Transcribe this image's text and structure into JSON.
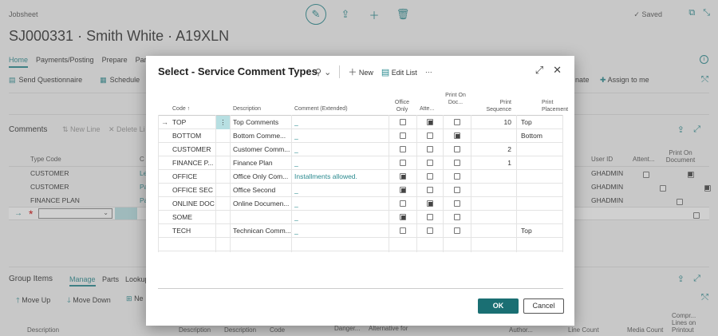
{
  "background": {
    "breadcrumb": "Jobsheet",
    "title": "SJ000331 · Smith White · A19XLN",
    "saved": "Saved",
    "nav": [
      "Home",
      "Payments/Posting",
      "Prepare",
      "Part"
    ],
    "actions": [
      "Send Questionnaire",
      "Schedule"
    ],
    "right_actions": [
      "nate",
      "Assign to me"
    ],
    "comments": {
      "title": "Comments",
      "new_line": "New Line",
      "delete_line": "Delete Li",
      "col_type_code": "Type Code",
      "col_c": "C",
      "col_user_id": "User ID",
      "col_atten": "Attent...",
      "col_print_on_doc": "Print On Document",
      "rows": [
        {
          "type": "CUSTOMER",
          "c": "Le",
          "user": "GHADMIN",
          "att": false,
          "print": true
        },
        {
          "type": "CUSTOMER",
          "c": "Pa",
          "user": "GHADMIN",
          "att": false,
          "print": true
        },
        {
          "type": "FINANCE PLAN",
          "c": "Pa",
          "user": "GHADMIN",
          "att": false,
          "print": false
        }
      ]
    },
    "group_items": {
      "title": "Group Items",
      "tabs": [
        "Manage",
        "Parts",
        "Lookup"
      ],
      "actions": [
        "Move Up",
        "Move Down",
        "Ne"
      ],
      "cols": [
        "Description",
        "Description",
        "Description",
        "Code",
        "Danger...",
        "Alternative for",
        "Author...",
        "Line Count",
        "Media Count",
        "Compr... Lines on Printout"
      ]
    }
  },
  "dialog": {
    "title": "Select - Service Comment Types",
    "new_label": "New",
    "edit_list_label": "Edit List",
    "more": "···",
    "headers": {
      "code": "Code ↑",
      "description": "Description",
      "comment": "Comment (Extended)",
      "office_only": "Office Only",
      "atten": "Atte...",
      "print_on_doc": "Print On Doc...",
      "print_sequence": "Print Sequence",
      "print_placement": "Print Placement"
    },
    "rows": [
      {
        "code": "TOP",
        "description": "Top Comments",
        "comment": "_",
        "office": false,
        "atten": true,
        "print": false,
        "seq": "10",
        "placement": "Top"
      },
      {
        "code": "BOTTOM",
        "description": "Bottom Comme...",
        "comment": "_",
        "office": false,
        "atten": false,
        "print": true,
        "seq": "",
        "placement": "Bottom"
      },
      {
        "code": "CUSTOMER",
        "description": "Customer Comm...",
        "comment": "_",
        "office": false,
        "atten": false,
        "print": false,
        "seq": "2",
        "placement": ""
      },
      {
        "code": "FINANCE P...",
        "description": "Finance Plan",
        "comment": "_",
        "office": false,
        "atten": false,
        "print": false,
        "seq": "1",
        "placement": ""
      },
      {
        "code": "OFFICE",
        "description": "Office Only Com...",
        "comment": "Installments allowed.",
        "office": true,
        "atten": false,
        "print": false,
        "seq": "",
        "placement": ""
      },
      {
        "code": "OFFICE SEC",
        "description": "Office Second",
        "comment": "_",
        "office": true,
        "atten": false,
        "print": false,
        "seq": "",
        "placement": ""
      },
      {
        "code": "ONLINE DOC",
        "description": "Online Documen...",
        "comment": "_",
        "office": false,
        "atten": true,
        "print": false,
        "seq": "",
        "placement": ""
      },
      {
        "code": "SOME",
        "description": "",
        "comment": "_",
        "office": true,
        "atten": false,
        "print": false,
        "seq": "",
        "placement": ""
      },
      {
        "code": "TECH",
        "description": "Technican Comm...",
        "comment": "_",
        "office": false,
        "atten": false,
        "print": false,
        "seq": "",
        "placement": "Top"
      }
    ],
    "ok_label": "OK",
    "cancel_label": "Cancel"
  }
}
